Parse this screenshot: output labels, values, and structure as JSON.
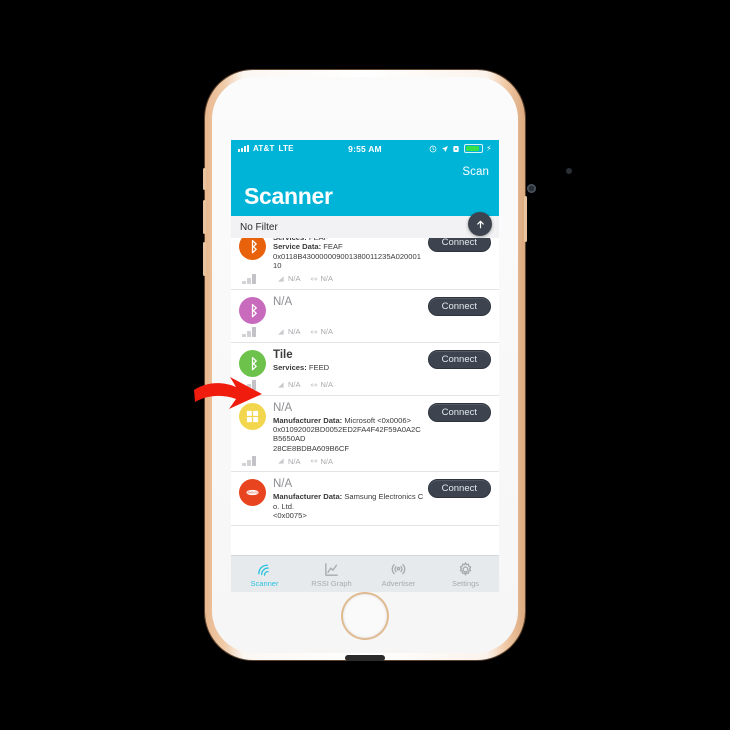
{
  "status_bar": {
    "carrier": "AT&T",
    "network": "LTE",
    "time": "9:55 AM",
    "icons": [
      "alarm-icon",
      "location-arrow-icon",
      "rotation-lock-icon",
      "battery-icon",
      "charging-bolt-icon"
    ]
  },
  "nav": {
    "title": "Scanner",
    "scan_label": "Scan",
    "accent": "#00b4d8"
  },
  "filter": {
    "label": "No Filter",
    "scroll_top_icon": "arrow-up-icon"
  },
  "list": {
    "connect_label": "Connect",
    "rssi_na": "N/A",
    "interval_na": "N/A",
    "rows": [
      {
        "name": "",
        "name_is_na": false,
        "avatar_color": "#e8620c",
        "avatar_icon": "bluetooth-icon",
        "lines": [
          {
            "label": "Services:",
            "value": " FEAF"
          },
          {
            "label": "Service Data:",
            "value": " FEAF"
          },
          {
            "label": "",
            "value": "0x0118B430000009001380011235A02000110"
          }
        ]
      },
      {
        "name": "N/A",
        "name_is_na": true,
        "avatar_color": "#c86bbd",
        "avatar_icon": "bluetooth-icon",
        "lines": []
      },
      {
        "name": "Tile",
        "name_is_na": false,
        "avatar_color": "#6cc24a",
        "avatar_icon": "bluetooth-icon",
        "lines": [
          {
            "label": "Services:",
            "value": " FEED"
          }
        ]
      },
      {
        "name": "N/A",
        "name_is_na": true,
        "avatar_color": "#f2d74e",
        "avatar_icon": "windows-icon",
        "lines": [
          {
            "label": "Manufacturer Data:",
            "value": " Microsoft <0x0006>"
          },
          {
            "label": "",
            "value": "0x01092002BD0052ED2FA4F42F59A0A2CB5650AD"
          },
          {
            "label": "",
            "value": "28CE8BDBA609B6CF"
          }
        ]
      },
      {
        "name": "N/A",
        "name_is_na": true,
        "avatar_color": "#e8441f",
        "avatar_icon": "samsung-icon",
        "lines": [
          {
            "label": "Manufacturer Data:",
            "value": " Samsung Electronics Co. Ltd."
          },
          {
            "label": "",
            "value": "<0x0075>"
          }
        ]
      }
    ]
  },
  "tabbar": {
    "active_color": "#29c2e0",
    "tabs": [
      {
        "label": "Scanner",
        "icon": "scanner-waves-icon",
        "active": true
      },
      {
        "label": "RSSI Graph",
        "icon": "line-chart-icon",
        "active": false
      },
      {
        "label": "Advertiser",
        "icon": "broadcast-icon",
        "active": false
      },
      {
        "label": "Settings",
        "icon": "gear-icon",
        "active": false
      }
    ]
  },
  "annotation": {
    "arrow_color": "#f01c0e",
    "points_at": "Tile"
  }
}
